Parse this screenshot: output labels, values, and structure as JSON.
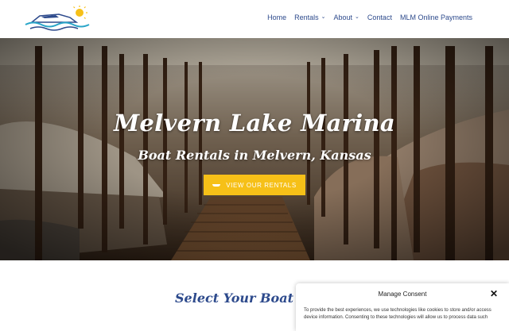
{
  "header": {
    "logo_icon": "boat-sun-logo",
    "nav": [
      {
        "label": "Home",
        "dropdown": false
      },
      {
        "label": "Rentals",
        "dropdown": true
      },
      {
        "label": "About",
        "dropdown": true
      },
      {
        "label": "Contact",
        "dropdown": false
      },
      {
        "label": "MLM Online Payments",
        "dropdown": false
      }
    ]
  },
  "hero": {
    "title": "Melvern Lake Marina",
    "subtitle": "Boat Rentals in Melvern, Kansas",
    "cta_label": "VIEW OUR RENTALS",
    "cta_icon": "boat-icon"
  },
  "section": {
    "title": "Select Your Boat R"
  },
  "consent": {
    "title": "Manage Consent",
    "text": "To provide the best experiences, we use technologies like cookies to store and/or access device information. Consenting to these technologies will allow us to process data such"
  },
  "colors": {
    "nav_text": "#2d4a8c",
    "cta_bg": "#f6c018",
    "heading": "#2d4a8c"
  }
}
